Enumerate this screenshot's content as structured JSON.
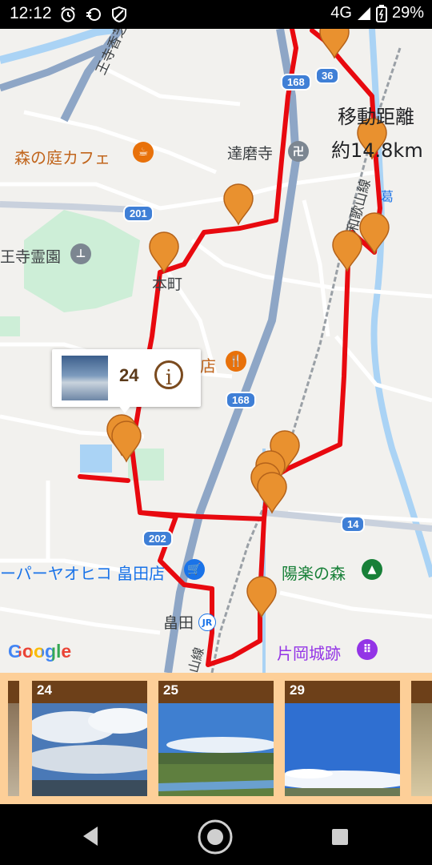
{
  "status_bar": {
    "time": "12:12",
    "network": "4G",
    "battery": "29%"
  },
  "map": {
    "labels": {
      "cafe": "森の庭カフェ",
      "temple": "達磨寺",
      "cemetery": "王寺霊園",
      "honmachi": "本町",
      "shop_partial": "店",
      "supermarket": "ーパーヤオヒコ 畠田店",
      "forest": "陽楽の森",
      "station": "畠田",
      "castle": "片岡城跡",
      "rail_wakayama": "和歌山線",
      "rail_bottom": "山線",
      "road_top_left": "王寺香芝",
      "river_partial": "葛"
    },
    "distance": {
      "line1": "移動距離",
      "line2": "約14.8km"
    },
    "road_shields": [
      "168",
      "36",
      "201",
      "168",
      "202",
      "14"
    ],
    "google_logo": "Google",
    "popup": {
      "number": "24",
      "info_icon": "i"
    },
    "colors": {
      "route": "#e8090f",
      "marker": "#e9912f",
      "marker_outline": "#b4621a"
    }
  },
  "photo_strip": {
    "cards": [
      {
        "number": "24"
      },
      {
        "number": "25"
      },
      {
        "number": "29"
      }
    ]
  }
}
